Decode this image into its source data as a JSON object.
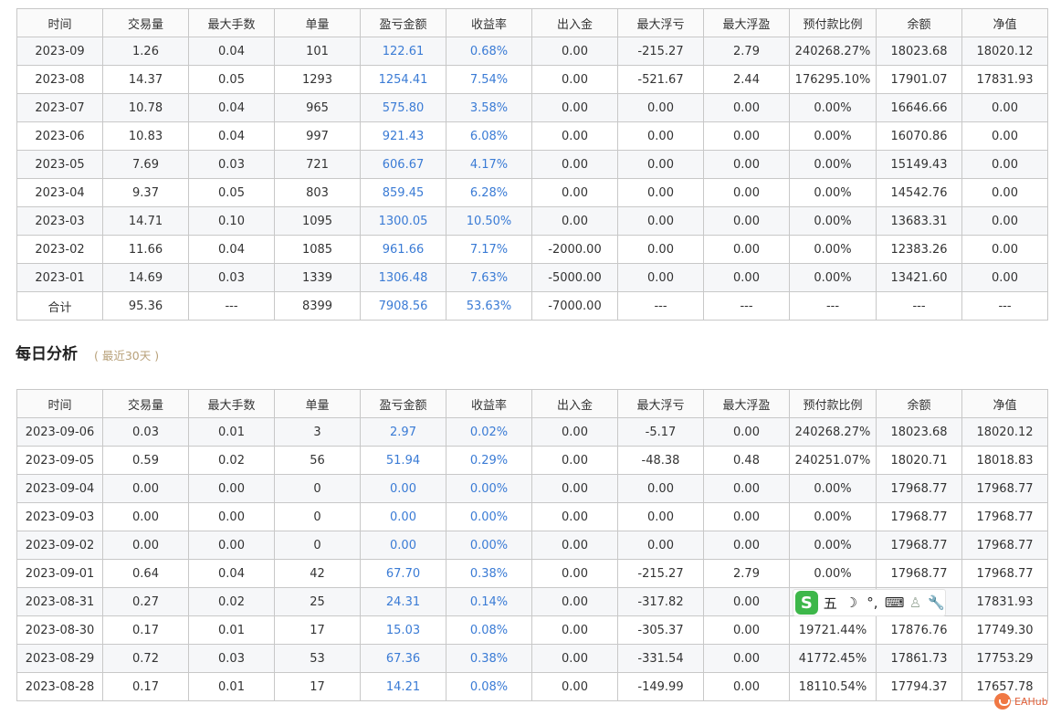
{
  "columns": [
    "时间",
    "交易量",
    "最大手数",
    "单量",
    "盈亏金额",
    "收益率",
    "出入金",
    "最大浮亏",
    "最大浮盈",
    "预付款比例",
    "余额",
    "净值"
  ],
  "monthly_rows": [
    [
      "2023-09",
      "1.26",
      "0.04",
      "101",
      "122.61",
      "0.68%",
      "0.00",
      "-215.27",
      "2.79",
      "240268.27%",
      "18023.68",
      "18020.12"
    ],
    [
      "2023-08",
      "14.37",
      "0.05",
      "1293",
      "1254.41",
      "7.54%",
      "0.00",
      "-521.67",
      "2.44",
      "176295.10%",
      "17901.07",
      "17831.93"
    ],
    [
      "2023-07",
      "10.78",
      "0.04",
      "965",
      "575.80",
      "3.58%",
      "0.00",
      "0.00",
      "0.00",
      "0.00%",
      "16646.66",
      "0.00"
    ],
    [
      "2023-06",
      "10.83",
      "0.04",
      "997",
      "921.43",
      "6.08%",
      "0.00",
      "0.00",
      "0.00",
      "0.00%",
      "16070.86",
      "0.00"
    ],
    [
      "2023-05",
      "7.69",
      "0.03",
      "721",
      "606.67",
      "4.17%",
      "0.00",
      "0.00",
      "0.00",
      "0.00%",
      "15149.43",
      "0.00"
    ],
    [
      "2023-04",
      "9.37",
      "0.05",
      "803",
      "859.45",
      "6.28%",
      "0.00",
      "0.00",
      "0.00",
      "0.00%",
      "14542.76",
      "0.00"
    ],
    [
      "2023-03",
      "14.71",
      "0.10",
      "1095",
      "1300.05",
      "10.50%",
      "0.00",
      "0.00",
      "0.00",
      "0.00%",
      "13683.31",
      "0.00"
    ],
    [
      "2023-02",
      "11.66",
      "0.04",
      "1085",
      "961.66",
      "7.17%",
      "-2000.00",
      "0.00",
      "0.00",
      "0.00%",
      "12383.26",
      "0.00"
    ],
    [
      "2023-01",
      "14.69",
      "0.03",
      "1339",
      "1306.48",
      "7.63%",
      "-5000.00",
      "0.00",
      "0.00",
      "0.00%",
      "13421.60",
      "0.00"
    ],
    [
      "合计",
      "95.36",
      "---",
      "8399",
      "7908.56",
      "53.63%",
      "-7000.00",
      "---",
      "---",
      "---",
      "---",
      "---"
    ]
  ],
  "daily_section": {
    "title": "每日分析",
    "subtitle": "( 最近30天 )"
  },
  "daily_rows": [
    [
      "2023-09-06",
      "0.03",
      "0.01",
      "3",
      "2.97",
      "0.02%",
      "0.00",
      "-5.17",
      "0.00",
      "240268.27%",
      "18023.68",
      "18020.12"
    ],
    [
      "2023-09-05",
      "0.59",
      "0.02",
      "56",
      "51.94",
      "0.29%",
      "0.00",
      "-48.38",
      "0.48",
      "240251.07%",
      "18020.71",
      "18018.83"
    ],
    [
      "2023-09-04",
      "0.00",
      "0.00",
      "0",
      "0.00",
      "0.00%",
      "0.00",
      "0.00",
      "0.00",
      "0.00%",
      "17968.77",
      "17968.77"
    ],
    [
      "2023-09-03",
      "0.00",
      "0.00",
      "0",
      "0.00",
      "0.00%",
      "0.00",
      "0.00",
      "0.00",
      "0.00%",
      "17968.77",
      "17968.77"
    ],
    [
      "2023-09-02",
      "0.00",
      "0.00",
      "0",
      "0.00",
      "0.00%",
      "0.00",
      "0.00",
      "0.00",
      "0.00%",
      "17968.77",
      "17968.77"
    ],
    [
      "2023-09-01",
      "0.64",
      "0.04",
      "42",
      "67.70",
      "0.38%",
      "0.00",
      "-215.27",
      "2.79",
      "0.00%",
      "17968.77",
      "17968.77"
    ],
    [
      "2023-08-31",
      "0.27",
      "0.02",
      "25",
      "24.31",
      "0.14%",
      "0.00",
      "-317.82",
      "0.00",
      "",
      "",
      "17831.93"
    ],
    [
      "2023-08-30",
      "0.17",
      "0.01",
      "17",
      "15.03",
      "0.08%",
      "0.00",
      "-305.37",
      "0.00",
      "19721.44%",
      "17876.76",
      "17749.30"
    ],
    [
      "2023-08-29",
      "0.72",
      "0.03",
      "53",
      "67.36",
      "0.38%",
      "0.00",
      "-331.54",
      "0.00",
      "41772.45%",
      "17861.73",
      "17753.29"
    ],
    [
      "2023-08-28",
      "0.17",
      "0.01",
      "17",
      "14.21",
      "0.08%",
      "0.00",
      "-149.99",
      "0.00",
      "18110.54%",
      "17794.37",
      "17657.78"
    ]
  ],
  "ime_toolbar": {
    "logo": "S",
    "items": [
      {
        "icon": "wubi-mode-icon",
        "glyph": "五"
      },
      {
        "icon": "moon-icon",
        "glyph": "☽"
      },
      {
        "icon": "punctuation-icon",
        "glyph": "°,"
      },
      {
        "icon": "keyboard-icon",
        "glyph": "⌨"
      },
      {
        "icon": "user-icon",
        "glyph": "♙"
      },
      {
        "icon": "wrench-icon",
        "glyph": "🔧"
      }
    ]
  },
  "watermark": {
    "text": "EAHub"
  },
  "colors": {
    "link_blue": "#3a7bd5",
    "border": "#c8c8c8",
    "subtitle": "#b8a17a",
    "ime_green": "#3db74a"
  }
}
